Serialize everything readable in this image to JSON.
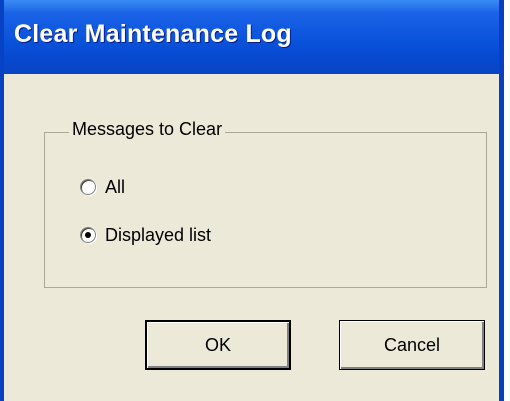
{
  "window": {
    "title": "Clear Maintenance Log",
    "colors": {
      "titlebar": "#0a53db",
      "dialog_bg": "#ece9d8",
      "title_text": "#ffffff"
    }
  },
  "group": {
    "label": "Messages to Clear",
    "options": [
      {
        "label": "All",
        "selected": false
      },
      {
        "label": "Displayed list",
        "selected": true
      }
    ]
  },
  "buttons": {
    "ok_label": "OK",
    "cancel_label": "Cancel"
  }
}
